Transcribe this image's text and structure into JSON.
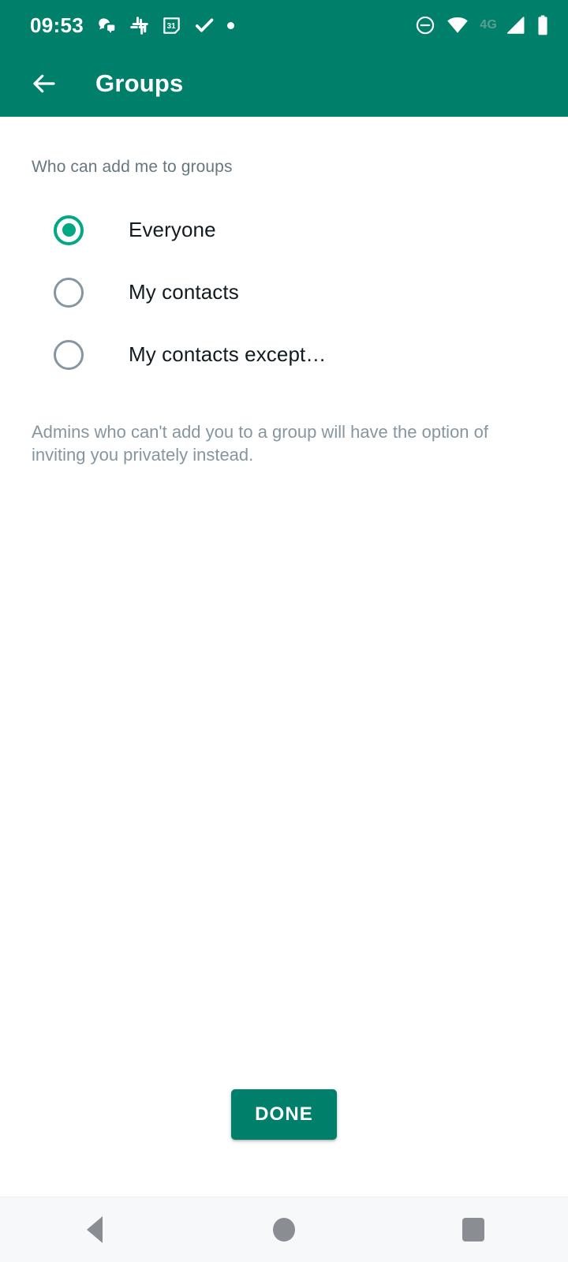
{
  "status_bar": {
    "time": "09:53",
    "left_icons": [
      {
        "name": "messaging-notification-icon",
        "glyph": "notif"
      },
      {
        "name": "slack-icon",
        "glyph": "slack"
      },
      {
        "name": "calendar-icon",
        "glyph": "calendar",
        "day": "31"
      },
      {
        "name": "checkmark-icon",
        "glyph": "check"
      },
      {
        "name": "dot-notification-icon",
        "glyph": "dot"
      }
    ],
    "right_icons": [
      {
        "name": "do-not-disturb-icon",
        "glyph": "dnd"
      },
      {
        "name": "wifi-icon",
        "glyph": "wifi"
      },
      {
        "name": "network-type-label",
        "glyph": "text",
        "text": "4G"
      },
      {
        "name": "cellular-signal-icon",
        "glyph": "signal"
      },
      {
        "name": "battery-icon",
        "glyph": "battery"
      }
    ],
    "network_type": "4G",
    "background_color": "#00806B"
  },
  "app_bar": {
    "back_label": "Back",
    "title": "Groups",
    "background_color": "#00806B",
    "title_color": "#FFFFFF"
  },
  "main": {
    "section_title": "Who can add me to groups",
    "options": [
      {
        "label": "Everyone",
        "selected": true
      },
      {
        "label": "My contacts",
        "selected": false
      },
      {
        "label": "My contacts except…",
        "selected": false
      }
    ],
    "footnote": "Admins who can't add you to a group will have the option of inviting you privately instead.",
    "accent_color": "#00A884",
    "muted_text_color": "#8696A0"
  },
  "actions": {
    "done_label": "DONE",
    "done_color": "#00806B"
  },
  "nav_bar": {
    "back_label": "Back",
    "home_label": "Home",
    "recents_label": "Recents",
    "background_color": "#F7F8FA",
    "icon_color": "#8A8D91"
  }
}
